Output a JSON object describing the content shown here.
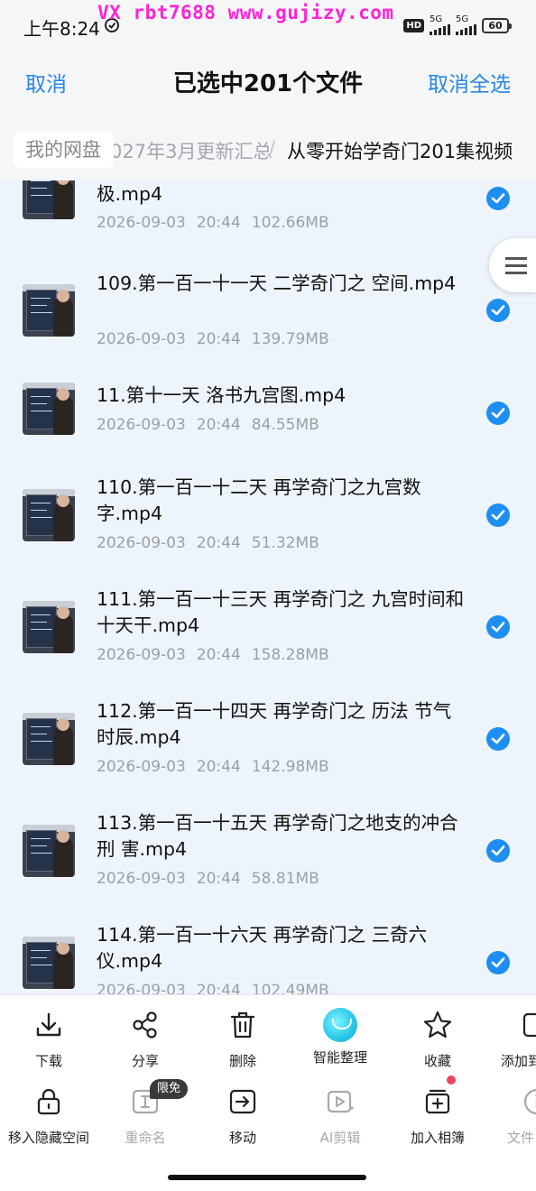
{
  "status_bar": {
    "time": "上午8:24",
    "watermark": "VX rbt7688  www.gujizy.com",
    "hd": "HD",
    "signal_1": "5G",
    "signal_2": "5G",
    "battery": "60"
  },
  "header": {
    "cancel_label": "取消",
    "title": "已选中201个文件",
    "cancel_all_label": "取消全选"
  },
  "breadcrumb": {
    "root": "我的网盘",
    "middle": "027年3月更新汇总",
    "separator": "/",
    "current": "从零开始学奇门201集视频"
  },
  "files": [
    {
      "name": "极.mp4",
      "date": "2026-09-03",
      "time": "20:44",
      "size": "102.66MB",
      "checked": true
    },
    {
      "name": "109.第一百一十一天  二学奇门之 空间.mp4",
      "date": "2026-09-03",
      "time": "20:44",
      "size": "139.79MB",
      "checked": true
    },
    {
      "name": "11.第十一天  洛书九宫图.mp4",
      "date": "2026-09-03",
      "time": "20:44",
      "size": "84.55MB",
      "checked": true
    },
    {
      "name": "110.第一百一十二天  再学奇门之九宫数字.mp4",
      "date": "2026-09-03",
      "time": "20:44",
      "size": "51.32MB",
      "checked": true
    },
    {
      "name": "111.第一百一十三天  再学奇门之 九宫时间和十天干.mp4",
      "date": "2026-09-03",
      "time": "20:44",
      "size": "158.28MB",
      "checked": true
    },
    {
      "name": "112.第一百一十四天  再学奇门之 历法 节气 时辰.mp4",
      "date": "2026-09-03",
      "time": "20:44",
      "size": "142.98MB",
      "checked": true
    },
    {
      "name": "113.第一百一十五天  再学奇门之地支的冲合 刑 害.mp4",
      "date": "2026-09-03",
      "time": "20:44",
      "size": "58.81MB",
      "checked": true
    },
    {
      "name": "114.第一百一十六天 再学奇门之 三奇六仪.mp4",
      "date": "2026-09-03",
      "time": "20:44",
      "size": "102.49MB",
      "checked": true
    }
  ],
  "actions_row1": [
    {
      "label": "下载",
      "icon": "download-icon"
    },
    {
      "label": "分享",
      "icon": "share-icon"
    },
    {
      "label": "删除",
      "icon": "trash-icon"
    },
    {
      "label": "智能整理",
      "icon": "ai-organize-icon"
    },
    {
      "label": "收藏",
      "icon": "star-icon"
    },
    {
      "label": "添加到",
      "icon": "add-to-icon"
    }
  ],
  "actions_row2": [
    {
      "label": "移入隐藏空间",
      "icon": "lock-icon"
    },
    {
      "label": "重命名",
      "icon": "rename-icon"
    },
    {
      "label": "移动",
      "icon": "move-icon"
    },
    {
      "label": "AI剪辑",
      "icon": "ai-clip-icon"
    },
    {
      "label": "加入相簿",
      "icon": "add-album-icon"
    },
    {
      "label": "文件",
      "icon": "info-icon"
    }
  ],
  "free_badge": "限免",
  "colors": {
    "accent": "#2a86e6",
    "check": "#1e8ff0",
    "watermark": "#ff23d6",
    "red_dot": "#f24462"
  }
}
